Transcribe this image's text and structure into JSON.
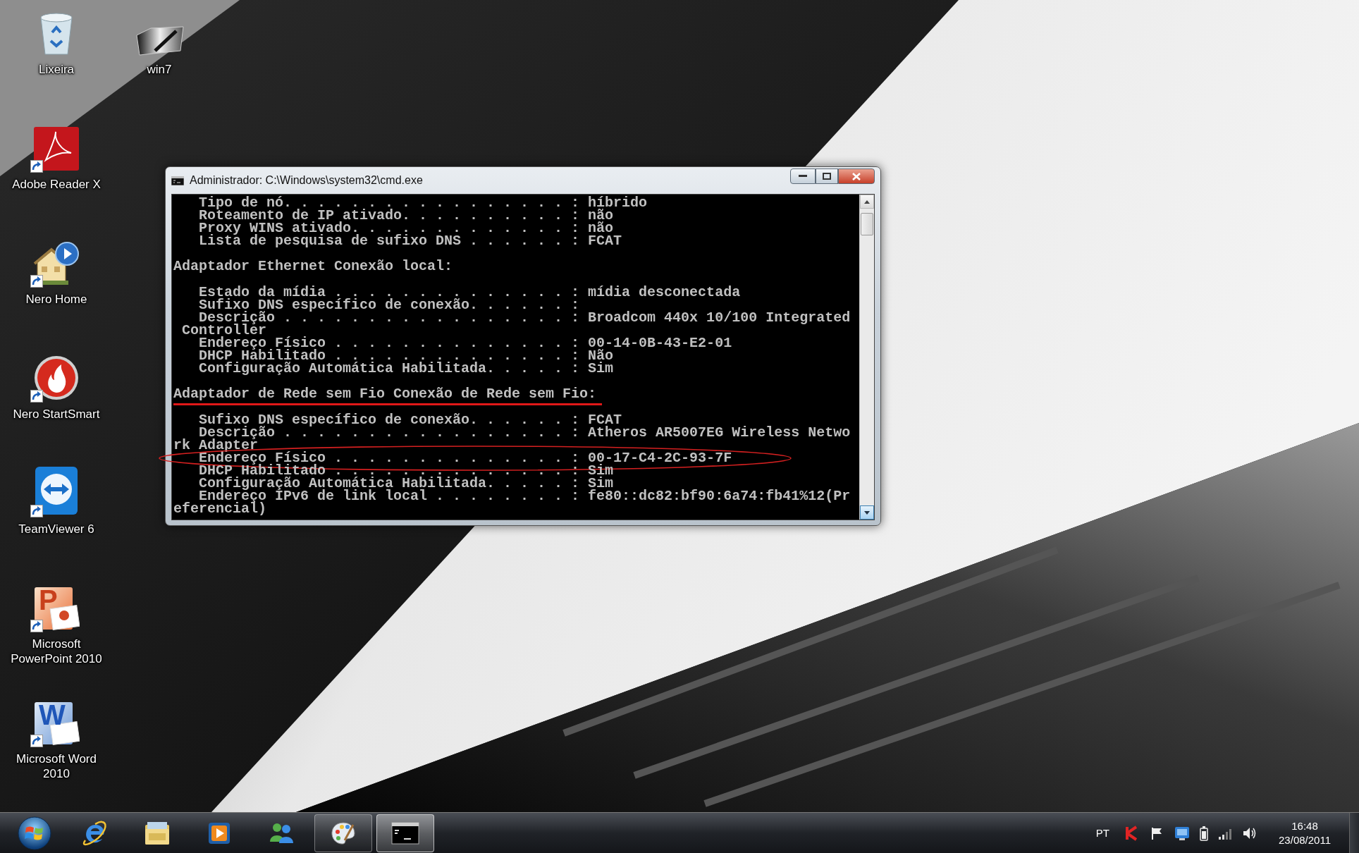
{
  "desktop_icons": [
    {
      "label": "Lixeira",
      "kind": "recycle-bin",
      "shortcut": false
    },
    {
      "label": "win7",
      "kind": "image",
      "shortcut": false
    },
    {
      "label": "Adobe Reader X",
      "kind": "pdf",
      "shortcut": true
    },
    {
      "label": "Nero Home",
      "kind": "house",
      "shortcut": true
    },
    {
      "label": "Nero StartSmart",
      "kind": "flame",
      "shortcut": true
    },
    {
      "label": "TeamViewer 6",
      "kind": "arrows",
      "shortcut": true
    },
    {
      "label": "Microsoft PowerPoint 2010",
      "kind": "slides",
      "shortcut": true,
      "logo_letter": "P"
    },
    {
      "label": "Microsoft Word 2010",
      "kind": "document",
      "shortcut": true,
      "logo_letter": "W"
    }
  ],
  "console_window": {
    "title": "Administrador: C:\\Windows\\system32\\cmd.exe",
    "blocks": [
      {
        "lines": [
          {
            "kind": "plain",
            "text": "   Tipo de nó. . . . . . . . . . . . . . . . . : híbrido"
          },
          {
            "kind": "plain",
            "text": "   Roteamento de IP ativado. . . . . . . . . . : não"
          },
          {
            "kind": "plain",
            "text": "   Proxy WINS ativado. . . . . . . . . . . . . : não"
          },
          {
            "kind": "plain",
            "text": "   Lista de pesquisa de sufixo DNS . . . . . . : FCAT"
          }
        ]
      },
      {
        "lines": [
          {
            "kind": "plain",
            "text": "Adaptador Ethernet Conexão local:"
          }
        ]
      },
      {
        "lines": [
          {
            "kind": "plain",
            "text": "   Estado da mídia . . . . . . . . . . . . . . : mídia desconectada"
          },
          {
            "kind": "plain",
            "text": "   Sufixo DNS específico de conexão. . . . . . :"
          },
          {
            "kind": "plain",
            "text": "   Descrição . . . . . . . . . . . . . . . . . : Broadcom 440x 10/100 Integrated"
          },
          {
            "kind": "plain",
            "text": " Controller"
          },
          {
            "kind": "plain",
            "text": "   Endereço Físico . . . . . . . . . . . . . . : 00-14-0B-43-E2-01"
          },
          {
            "kind": "plain",
            "text": "   DHCP Habilitado . . . . . . . . . . . . . . : Não"
          },
          {
            "kind": "plain",
            "text": "   Configuração Automática Habilitada. . . . . : Sim"
          }
        ]
      },
      {
        "lines": [
          {
            "kind": "underlined",
            "text": "Adaptador de Rede sem Fio Conexão de Rede sem Fio:"
          }
        ]
      },
      {
        "lines": [
          {
            "kind": "plain",
            "text": "   Sufixo DNS específico de conexão. . . . . . : FCAT"
          },
          {
            "kind": "plain",
            "text": "   Descrição . . . . . . . . . . . . . . . . . : Atheros AR5007EG Wireless Netwo"
          },
          {
            "kind": "plain",
            "text": "rk Adapter"
          },
          {
            "kind": "circled",
            "text": "   Endereço Físico . . . . . . . . . . . . . . : 00-17-C4-2C-93-7F"
          },
          {
            "kind": "plain",
            "text": "   DHCP Habilitado . . . . . . . . . . . . . . : Sim"
          },
          {
            "kind": "plain",
            "text": "   Configuração Automática Habilitada. . . . . : Sim"
          },
          {
            "kind": "plain",
            "text": "   Endereço IPv6 de link local . . . . . . . . : fe80::dc82:bf90:6a74:fb41%12(Pr"
          },
          {
            "kind": "plain",
            "text": "eferencial)"
          }
        ]
      }
    ]
  },
  "taskbar": {
    "apps": [
      {
        "kind": "browser",
        "running": false,
        "selected": false
      },
      {
        "kind": "folder",
        "running": false,
        "selected": false
      },
      {
        "kind": "media",
        "running": false,
        "selected": false
      },
      {
        "kind": "people",
        "running": false,
        "selected": false
      },
      {
        "kind": "paint",
        "running": true,
        "selected": false
      },
      {
        "kind": "console",
        "running": true,
        "selected": true
      }
    ],
    "tray": {
      "language": "PT",
      "icons": [
        {
          "kind": "security"
        },
        {
          "kind": "flag"
        },
        {
          "kind": "monitor"
        },
        {
          "kind": "battery"
        },
        {
          "kind": "signal"
        },
        {
          "kind": "speaker"
        }
      ],
      "time": "16:48",
      "date": "23/08/2011"
    }
  }
}
